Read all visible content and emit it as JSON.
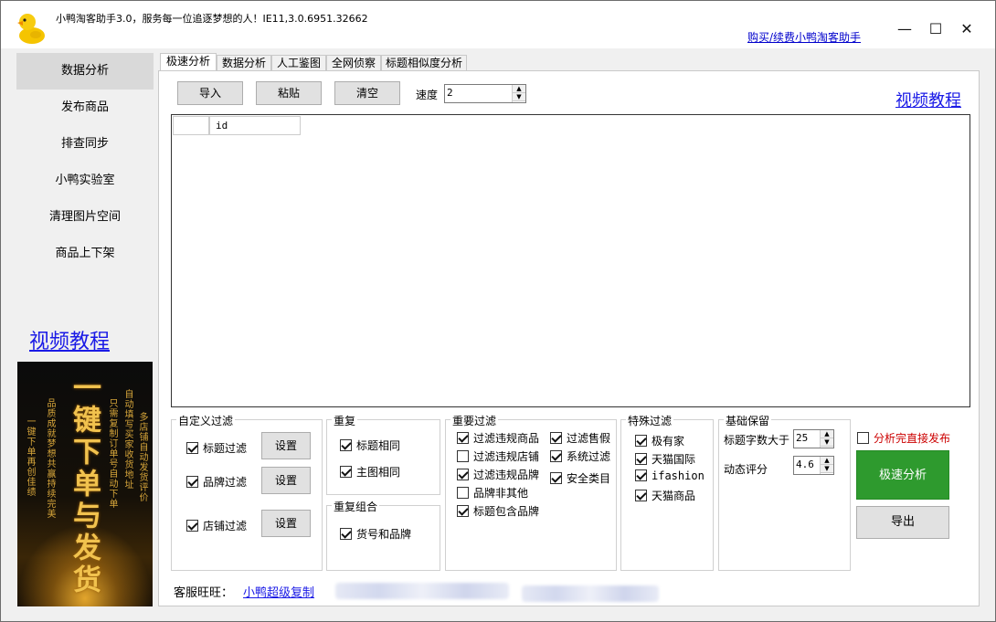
{
  "window": {
    "title": "小鸭淘客助手3.0，服务每一位追逐梦想的人！IE11,3.0.6951.32662",
    "buy_link": "购买/续费小鸭淘客助手",
    "controls": {
      "minimize": "—",
      "maximize": "☐",
      "close": "✕"
    }
  },
  "sidebar": {
    "items": [
      {
        "label": "数据分析",
        "active": true
      },
      {
        "label": "发布商品"
      },
      {
        "label": "排查同步"
      },
      {
        "label": "小鸭实验室"
      },
      {
        "label": "清理图片空间"
      },
      {
        "label": "商品上下架"
      }
    ],
    "video_link": "视频教程",
    "ad": {
      "big_text": "一键下单与发货",
      "left_col_1": "一键下单再创佳绩",
      "left_col_2": "品质成就梦想共赢持续完美",
      "right_col_1": "只需复制订单号自动下单",
      "right_col_2": "自动填写买家收货地址",
      "right_col_3": "多店铺自动发货评价"
    }
  },
  "tabs": [
    "极速分析",
    "数据分析",
    "人工鉴图",
    "全网侦察",
    "标题相似度分析"
  ],
  "toolbar": {
    "import": "导入",
    "paste": "粘贴",
    "clear": "清空",
    "speed_label": "速度",
    "speed_value": "2",
    "video_link": "视频教程"
  },
  "grid": {
    "columns": [
      "id"
    ]
  },
  "custom_filter": {
    "title": "自定义过滤",
    "items": [
      {
        "label": "标题过滤",
        "checked": true,
        "button": "设置"
      },
      {
        "label": "品牌过滤",
        "checked": true,
        "button": "设置"
      },
      {
        "label": "店铺过滤",
        "checked": true,
        "button": "设置"
      }
    ]
  },
  "repeat": {
    "title": "重复",
    "items": [
      {
        "label": "标题相同",
        "checked": true
      },
      {
        "label": "主图相同",
        "checked": true
      }
    ]
  },
  "repeat_combo": {
    "title": "重复组合",
    "items": [
      {
        "label": "货号和品牌",
        "checked": true
      }
    ]
  },
  "important_filter": {
    "title": "重要过滤",
    "left": [
      {
        "label": "过滤违规商品",
        "checked": true
      },
      {
        "label": "过滤违规店铺",
        "checked": false
      },
      {
        "label": "过滤违规品牌",
        "checked": true
      },
      {
        "label": "品牌非其他",
        "checked": false
      },
      {
        "label": "标题包含品牌",
        "checked": true
      }
    ],
    "right": [
      {
        "label": "过滤售假",
        "checked": true
      },
      {
        "label": "系统过滤",
        "checked": true
      },
      {
        "label": "安全类目",
        "checked": true
      }
    ]
  },
  "special_filter": {
    "title": "特殊过滤",
    "items": [
      {
        "label": "极有家",
        "checked": true
      },
      {
        "label": "天猫国际",
        "checked": true
      },
      {
        "label": "ifashion",
        "checked": true
      },
      {
        "label": "天猫商品",
        "checked": true
      }
    ]
  },
  "basic_keep": {
    "title": "基础保留",
    "title_len_label": "标题字数大于",
    "title_len_value": "25",
    "rating_label": "动态评分",
    "rating_value": "4.6"
  },
  "actions": {
    "auto_publish_label": "分析完直接发布",
    "auto_publish_checked": false,
    "auto_publish_color": "#cc0000",
    "analyze": "极速分析",
    "analyze_color": "#2e9a2e",
    "export": "导出"
  },
  "footer": {
    "service_label": "客服旺旺：",
    "service_link": "小鸭超级复制"
  }
}
